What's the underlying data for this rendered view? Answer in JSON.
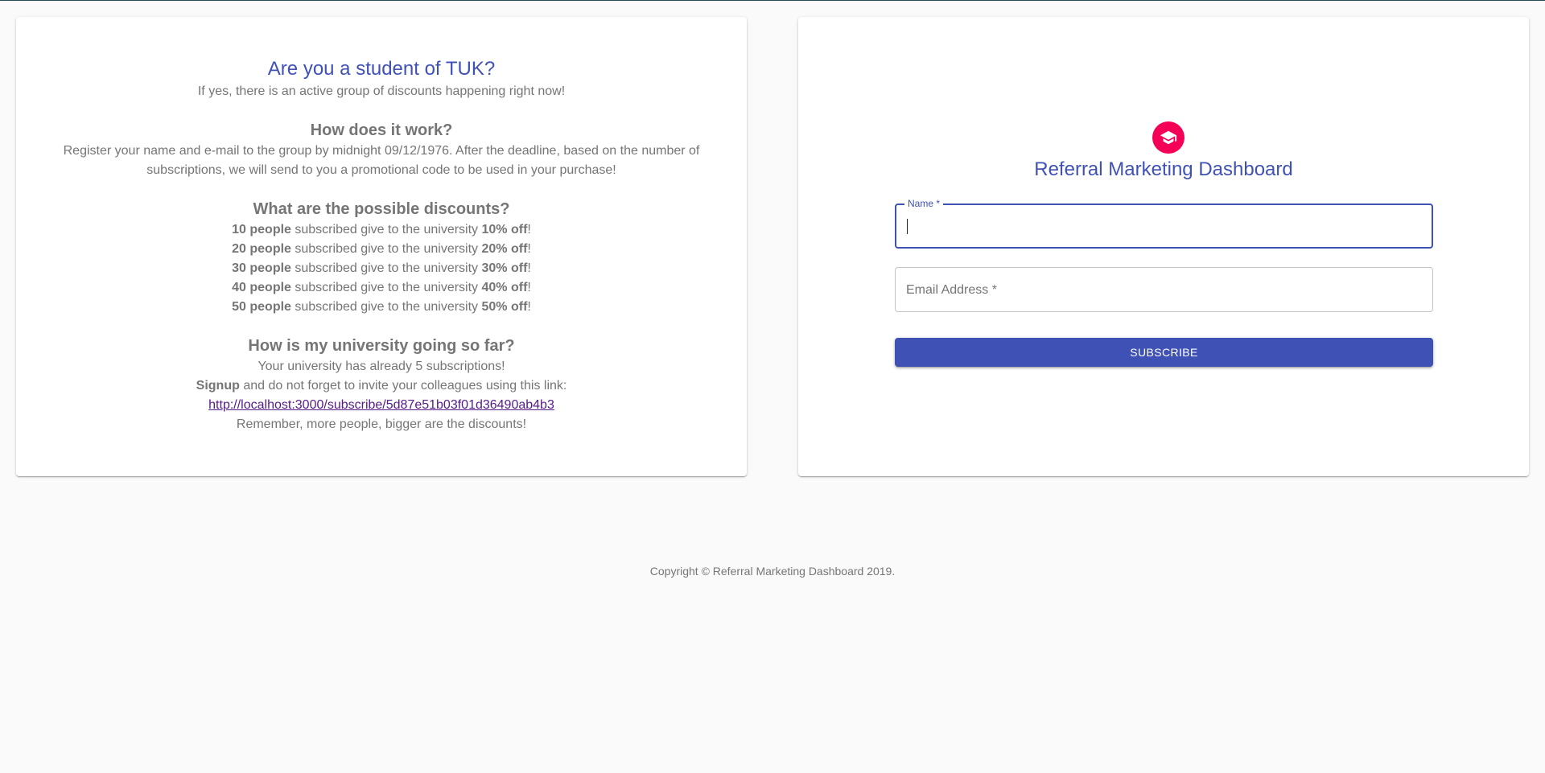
{
  "info": {
    "title": "Are you a student of TUK?",
    "subtitle": "If yes, there is an active group of discounts happening right now!",
    "how_heading": "How does it work?",
    "how_text": "Register your name and e-mail to the group by midnight 09/12/1976. After the deadline, based on the number of subscriptions, we will send to you a promotional code to be used in your purchase!",
    "discounts_heading": "What are the possible discounts?",
    "discounts": [
      {
        "people": "10 people",
        "middle": " subscribed give to the university ",
        "off": "10% off",
        "end": "!"
      },
      {
        "people": "20 people",
        "middle": " subscribed give to the university ",
        "off": "20% off",
        "end": "!"
      },
      {
        "people": "30 people",
        "middle": " subscribed give to the university ",
        "off": "30% off",
        "end": "!"
      },
      {
        "people": "40 people",
        "middle": " subscribed give to the university ",
        "off": "40% off",
        "end": "!"
      },
      {
        "people": "50 people",
        "middle": " subscribed give to the university ",
        "off": "50% off",
        "end": "!"
      }
    ],
    "progress_heading": "How is my university going so far?",
    "progress_text": "Your university has already 5 subscriptions!",
    "signup_bold": "Signup",
    "signup_text": " and do not forget to invite your colleagues using this link:",
    "invite_link": "http://localhost:3000/subscribe/5d87e51b03f01d36490ab4b3",
    "reminder": "Remember, more people, bigger are the discounts!"
  },
  "form": {
    "logo_icon": "graduation-cap-icon",
    "title": "Referral Marketing Dashboard",
    "name_label": "Name *",
    "name_value": "",
    "email_placeholder": "Email Address *",
    "subscribe_label": "SUBSCRIBE"
  },
  "footer": {
    "copyright": "Copyright © Referral Marketing Dashboard 2019."
  },
  "colors": {
    "primary": "#3f51b5",
    "secondary": "#f50057",
    "text": "#757575",
    "link": "#551a8b"
  }
}
